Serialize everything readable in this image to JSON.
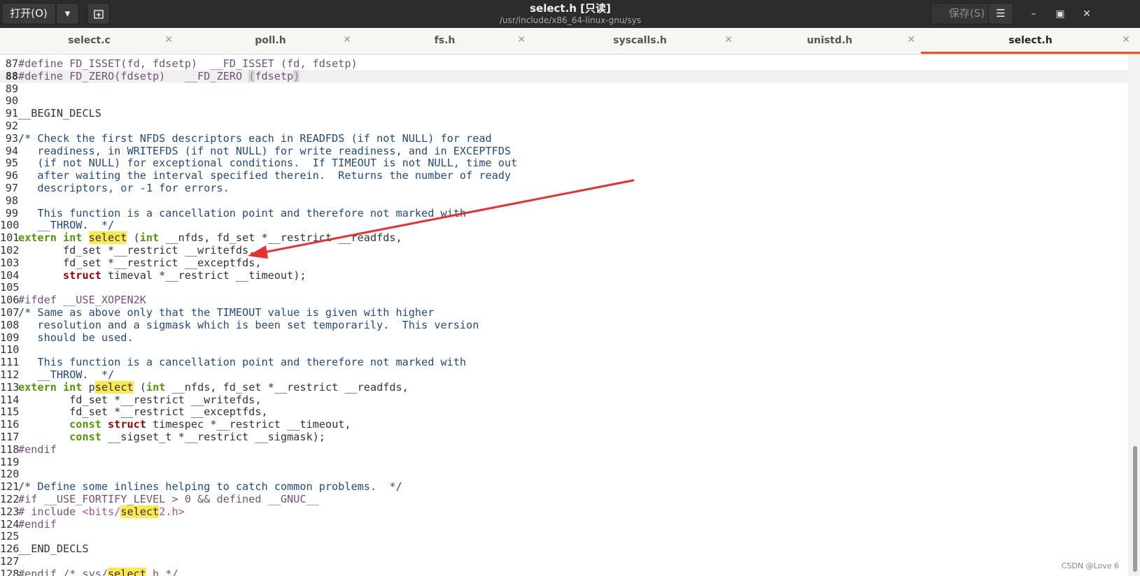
{
  "header": {
    "open_label": "打开(O)",
    "title": "select.h [只读]",
    "subtitle": "/usr/include/x86_64-linux-gnu/sys",
    "save_label": "保存(S)"
  },
  "tabs": [
    {
      "label": "select.c",
      "active": false
    },
    {
      "label": "poll.h",
      "active": false
    },
    {
      "label": "fs.h",
      "active": false
    },
    {
      "label": "syscalls.h",
      "active": false
    },
    {
      "label": "unistd.h",
      "active": false
    },
    {
      "label": "select.h",
      "active": true
    }
  ],
  "editor": {
    "current_line": 88,
    "lines": [
      {
        "n": "87",
        "s": [
          [
            "pp",
            "#define FD_ISSET(fd, fdsetp)  __FD_ISSET (fd, fdsetp)"
          ]
        ]
      },
      {
        "n": "88",
        "s": [
          [
            "pp",
            "#define FD_ZERO(fdsetp)   __FD_ZERO "
          ],
          [
            "br",
            "("
          ],
          [
            "pp",
            "fdsetp"
          ],
          [
            "br",
            ")"
          ]
        ]
      },
      {
        "n": "89",
        "s": []
      },
      {
        "n": "90",
        "s": []
      },
      {
        "n": "91",
        "s": [
          [
            "",
            "__BEGIN_DECLS"
          ]
        ]
      },
      {
        "n": "92",
        "s": []
      },
      {
        "n": "93",
        "s": [
          [
            "cm",
            "/* Check the first NFDS descriptors each in READFDS (if not NULL) for read"
          ]
        ]
      },
      {
        "n": "94",
        "s": [
          [
            "cm",
            "   readiness, in WRITEFDS (if not NULL) for write readiness, and in EXCEPTFDS"
          ]
        ]
      },
      {
        "n": "95",
        "s": [
          [
            "cm",
            "   (if not NULL) for exceptional conditions.  If TIMEOUT is not NULL, time out"
          ]
        ]
      },
      {
        "n": "96",
        "s": [
          [
            "cm",
            "   after waiting the interval specified therein.  Returns the number of ready"
          ]
        ]
      },
      {
        "n": "97",
        "s": [
          [
            "cm",
            "   descriptors, or -1 for errors."
          ]
        ]
      },
      {
        "n": "98",
        "s": []
      },
      {
        "n": "99",
        "s": [
          [
            "cm",
            "   This function is a cancellation point and therefore not marked with"
          ]
        ]
      },
      {
        "n": "100",
        "s": [
          [
            "cm",
            "   __THROW.  */"
          ]
        ]
      },
      {
        "n": "101",
        "s": [
          [
            "kw",
            "extern int "
          ],
          [
            "hl",
            "select"
          ],
          [
            "",
            " ("
          ],
          [
            "kw",
            "int"
          ],
          [
            "",
            " __nfds, fd_set *__restrict __readfds,"
          ]
        ]
      },
      {
        "n": "102",
        "s": [
          [
            "",
            "       fd_set *__restrict __writefds,"
          ]
        ]
      },
      {
        "n": "103",
        "s": [
          [
            "",
            "       fd_set *__restrict __exceptfds,"
          ]
        ]
      },
      {
        "n": "104",
        "s": [
          [
            "",
            "       "
          ],
          [
            "st",
            "struct"
          ],
          [
            "",
            " timeval *__restrict __timeout);"
          ]
        ]
      },
      {
        "n": "105",
        "s": []
      },
      {
        "n": "106",
        "s": [
          [
            "pp",
            "#ifdef __USE_XOPEN2K"
          ]
        ]
      },
      {
        "n": "107",
        "s": [
          [
            "cm",
            "/* Same as above only that the TIMEOUT value is given with higher"
          ]
        ]
      },
      {
        "n": "108",
        "s": [
          [
            "cm",
            "   resolution and a sigmask which is been set temporarily.  This version"
          ]
        ]
      },
      {
        "n": "109",
        "s": [
          [
            "cm",
            "   should be used."
          ]
        ]
      },
      {
        "n": "110",
        "s": []
      },
      {
        "n": "111",
        "s": [
          [
            "cm",
            "   This function is a cancellation point and therefore not marked with"
          ]
        ]
      },
      {
        "n": "112",
        "s": [
          [
            "cm",
            "   __THROW.  */"
          ]
        ]
      },
      {
        "n": "113",
        "s": [
          [
            "kw",
            "extern int "
          ],
          [
            "",
            "p"
          ],
          [
            "hl",
            "select"
          ],
          [
            "",
            " ("
          ],
          [
            "kw",
            "int"
          ],
          [
            "",
            " __nfds, fd_set *__restrict __readfds,"
          ]
        ]
      },
      {
        "n": "114",
        "s": [
          [
            "",
            "        fd_set *__restrict __writefds,"
          ]
        ]
      },
      {
        "n": "115",
        "s": [
          [
            "",
            "        fd_set *__restrict __exceptfds,"
          ]
        ]
      },
      {
        "n": "116",
        "s": [
          [
            "",
            "        "
          ],
          [
            "kw",
            "const"
          ],
          [
            "",
            " "
          ],
          [
            "st",
            "struct"
          ],
          [
            "",
            " timespec *__restrict __timeout,"
          ]
        ]
      },
      {
        "n": "117",
        "s": [
          [
            "",
            "        "
          ],
          [
            "kw",
            "const"
          ],
          [
            "",
            " __sigset_t *__restrict __sigmask);"
          ]
        ]
      },
      {
        "n": "118",
        "s": [
          [
            "pp",
            "#endif"
          ]
        ]
      },
      {
        "n": "119",
        "s": []
      },
      {
        "n": "120",
        "s": []
      },
      {
        "n": "121",
        "s": [
          [
            "cm",
            "/* Define some inlines helping to catch common problems.  */"
          ]
        ]
      },
      {
        "n": "122",
        "s": [
          [
            "pp",
            "#if __USE_FORTIFY_LEVEL > 0 && defined __GNUC__"
          ]
        ]
      },
      {
        "n": "123",
        "s": [
          [
            "pp",
            "# include "
          ],
          [
            "str",
            "<bits/"
          ],
          [
            "hl",
            "select"
          ],
          [
            "str",
            "2.h>"
          ]
        ]
      },
      {
        "n": "124",
        "s": [
          [
            "pp",
            "#endif"
          ]
        ]
      },
      {
        "n": "125",
        "s": []
      },
      {
        "n": "126",
        "s": [
          [
            "",
            "__END_DECLS"
          ]
        ]
      },
      {
        "n": "127",
        "s": []
      },
      {
        "n": "128",
        "s": [
          [
            "pp",
            "#endif /* sys/"
          ],
          [
            "hl",
            "select"
          ],
          [
            "pp",
            ".h */"
          ]
        ]
      }
    ]
  },
  "watermark": "CSDN @Love 6",
  "colors": {
    "accent": "#e95420",
    "annotation_arrow": "#e8302c"
  }
}
